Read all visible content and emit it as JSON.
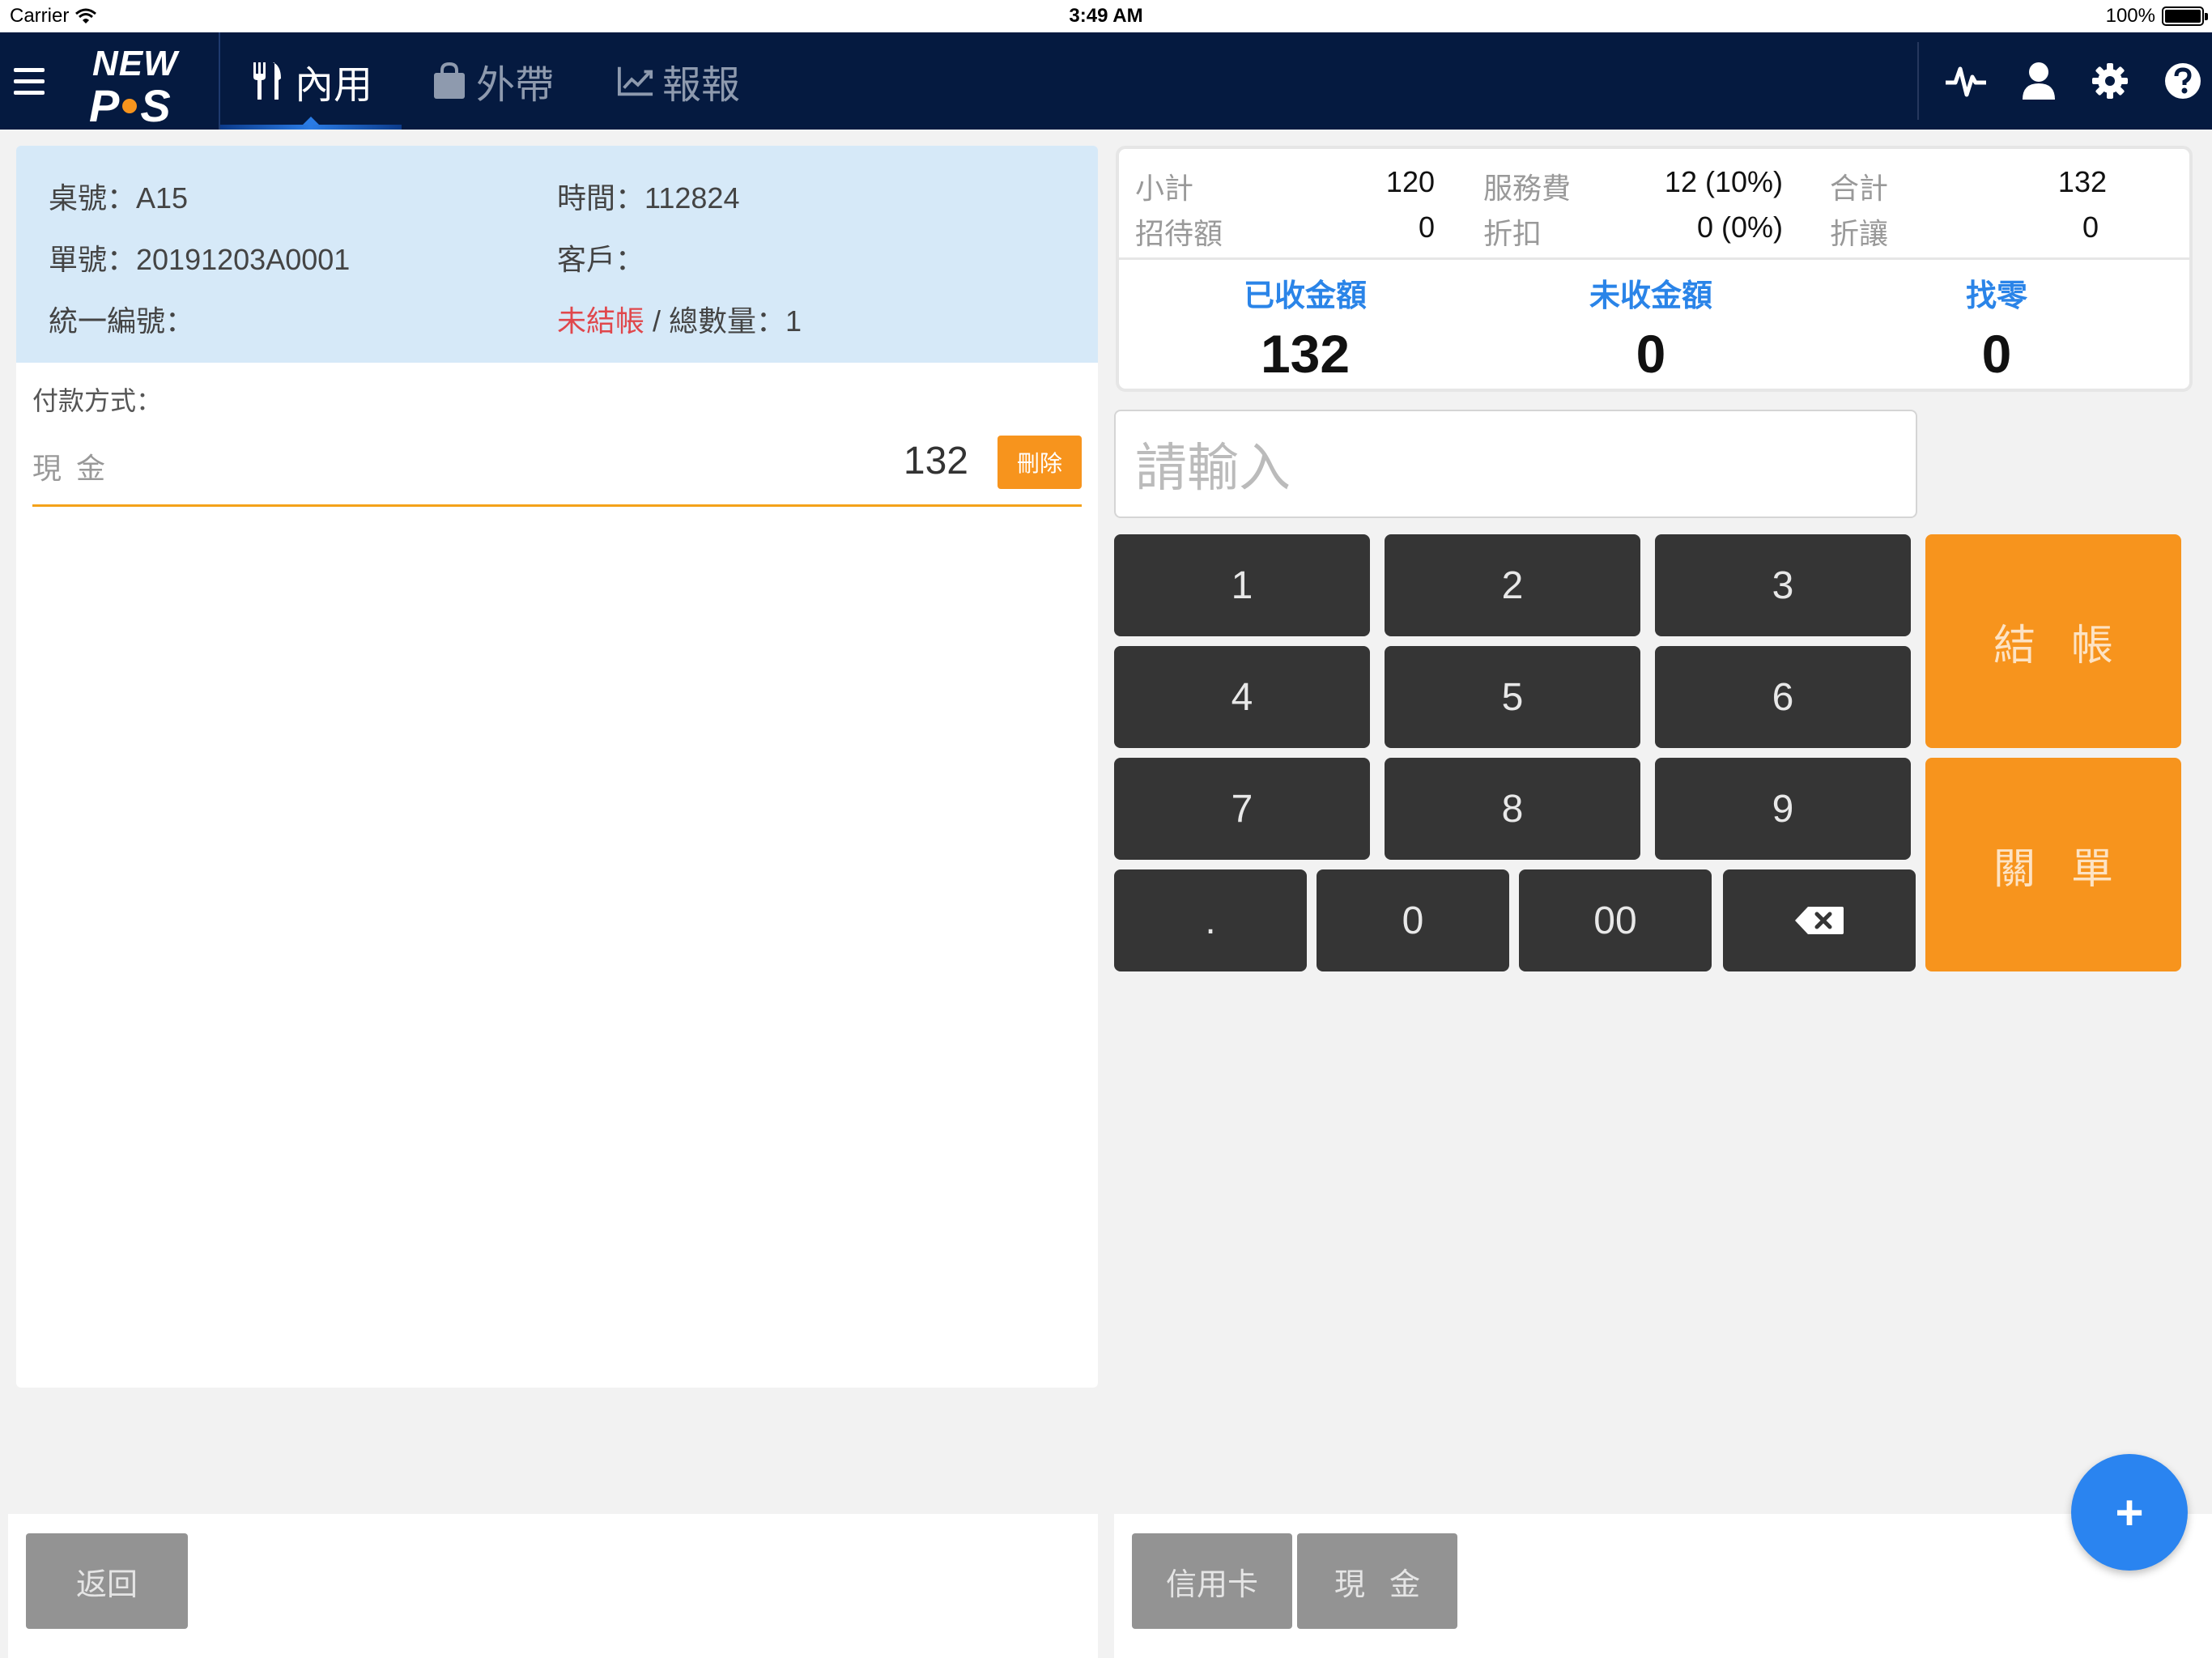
{
  "status_bar": {
    "carrier": "Carrier",
    "time": "3:49 AM",
    "battery": "100%"
  },
  "nav": {
    "logo_top": "NEW",
    "logo_bottom_left": "P",
    "logo_bottom_right": "S",
    "tabs": [
      {
        "label": "內用",
        "icon": "utensils-icon",
        "active": true
      },
      {
        "label": "外帶",
        "icon": "shopping-bag-icon",
        "active": false
      },
      {
        "label": "報報",
        "icon": "line-chart-icon",
        "active": false
      }
    ],
    "right_icons": [
      "heartbeat-icon",
      "user-icon",
      "gear-icon",
      "help-icon"
    ]
  },
  "order": {
    "table_label": "桌號：",
    "table_value": "A15",
    "time_label": "時間：",
    "time_value": "112824",
    "order_no_label": "單號：",
    "order_no_value": "20191203A0001",
    "customer_label": "客戶：",
    "customer_value": "",
    "tax_id_label": "統一編號：",
    "tax_id_value": "",
    "status": "未結帳",
    "separator": " / ",
    "quantity_label": "總數量：",
    "quantity_value": "1"
  },
  "payment": {
    "label": "付款方式：",
    "items": [
      {
        "method": "現金",
        "amount": "132",
        "delete_label": "刪除"
      }
    ]
  },
  "summary": {
    "subtotal_label": "小計",
    "subtotal": "120",
    "service_label": "服務費",
    "service": "12 (10%)",
    "total_label": "合計",
    "total": "132",
    "comp_label": "招待額",
    "comp": "0",
    "discount_label": "折扣",
    "discount": "0 (0%)",
    "allowance_label": "折讓",
    "allowance": "0",
    "received_label": "已收金額",
    "received": "132",
    "unpaid_label": "未收金額",
    "unpaid": "0",
    "change_label": "找零",
    "change": "0"
  },
  "input": {
    "placeholder": "請輸入"
  },
  "keypad": {
    "k1": "1",
    "k2": "2",
    "k3": "3",
    "k4": "4",
    "k5": "5",
    "k6": "6",
    "k7": "7",
    "k8": "8",
    "k9": "9",
    "kdot": ".",
    "k0": "0",
    "k00": "00",
    "backspace_icon": "backspace-icon",
    "checkout_label": "結帳",
    "close_order_label": "關單"
  },
  "bottom": {
    "back_label": "返回",
    "credit_card_label": "信用卡",
    "cash_label": "現金",
    "fab_label": "+"
  },
  "colors": {
    "nav_bg": "#051a40",
    "accent_orange": "#f7941d",
    "accent_blue": "#2a84e8",
    "status_red": "#e0474c",
    "info_bg": "#d6e9f8"
  }
}
